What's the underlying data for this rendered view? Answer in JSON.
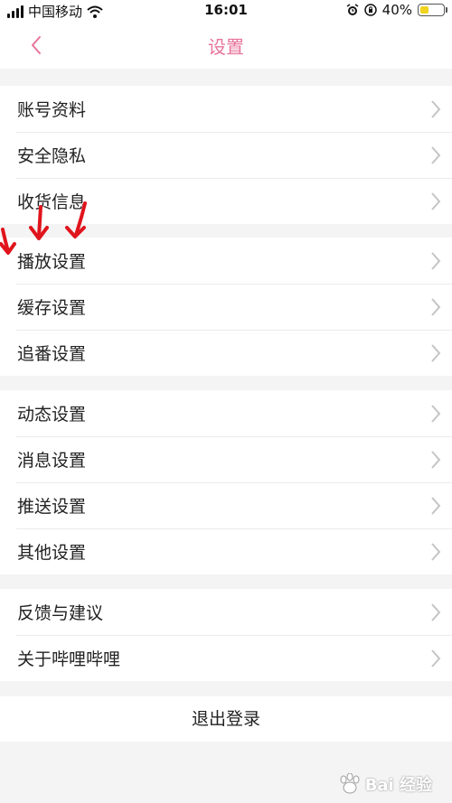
{
  "status_bar": {
    "carrier": "中国移动",
    "time": "16:01",
    "battery_percent": "40%",
    "battery_level": 0.4,
    "icons": [
      "signal-icon",
      "wifi-icon",
      "alarm-icon",
      "orientation-lock-icon",
      "battery-icon"
    ]
  },
  "nav": {
    "title": "设置",
    "back_icon": "chevron-left-icon"
  },
  "groups": [
    {
      "items": [
        {
          "label": "账号资料"
        },
        {
          "label": "安全隐私"
        },
        {
          "label": "收货信息"
        }
      ]
    },
    {
      "items": [
        {
          "label": "播放设置"
        },
        {
          "label": "缓存设置"
        },
        {
          "label": "追番设置"
        }
      ]
    },
    {
      "items": [
        {
          "label": "动态设置"
        },
        {
          "label": "消息设置"
        },
        {
          "label": "推送设置"
        },
        {
          "label": "其他设置"
        }
      ]
    },
    {
      "items": [
        {
          "label": "反馈与建议"
        },
        {
          "label": "关于哔哩哔哩"
        }
      ]
    }
  ],
  "logout_label": "退出登录",
  "watermark": {
    "text": "Bai 经验"
  },
  "colors": {
    "accent": "#e8739a",
    "annotation": "#e0141c",
    "background": "#f4f4f4"
  }
}
